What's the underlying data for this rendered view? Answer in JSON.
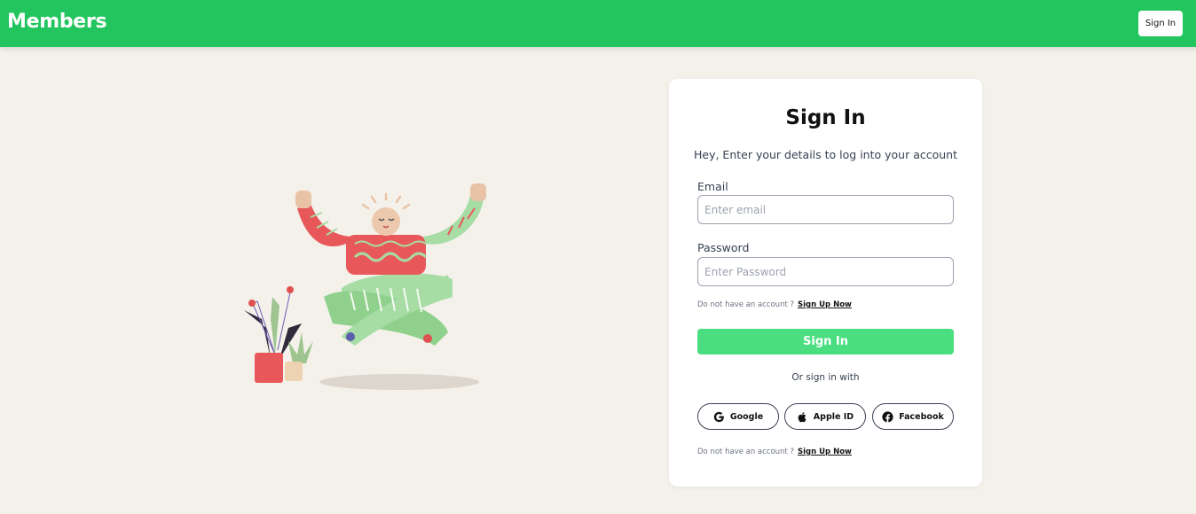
{
  "header": {
    "brand": "Members",
    "signin_label": "Sign In",
    "color": "#22c55e"
  },
  "illustration": {
    "icon": "meditating-character-illustration"
  },
  "form": {
    "title": "Sign In",
    "subtitle": "Hey, Enter your details to log into your account",
    "email": {
      "label": "Email",
      "placeholder": "Enter email",
      "value": ""
    },
    "password": {
      "label": "Password",
      "placeholder": "Enter Password",
      "value": ""
    },
    "signup_prompt": "Do not have an account ?",
    "signup_link": "Sign Up Now",
    "submit_label": "Sign In",
    "submit_color": "#4ade80",
    "divider": "Or sign in with",
    "social": [
      {
        "label": "Google",
        "icon": "google-icon"
      },
      {
        "label": "Apple ID",
        "icon": "apple-icon"
      },
      {
        "label": "Facebook",
        "icon": "facebook-icon"
      }
    ],
    "footer_prompt": "Do not have an account ?",
    "footer_link": "Sign Up Now"
  }
}
